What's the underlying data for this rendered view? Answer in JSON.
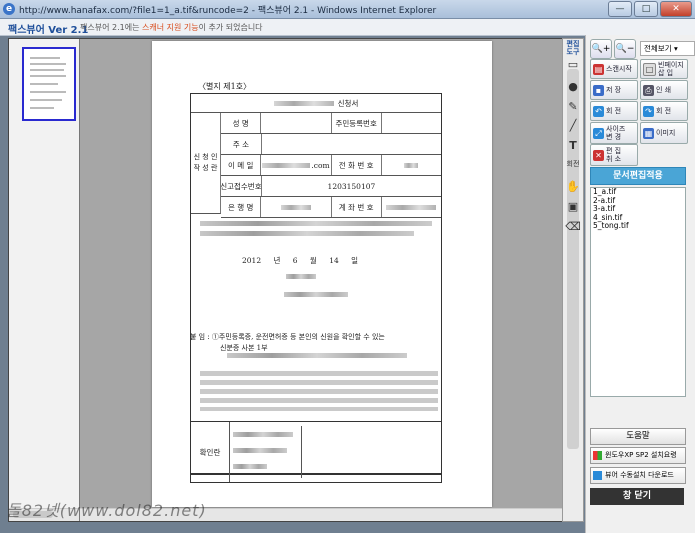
{
  "window": {
    "title": "http://www.hanafax.com/?file1=1_a.tif&runcode=2 - 팩스뷰어 2.1 - Windows Internet Explorer",
    "controls": {
      "minimize": "—",
      "maximize": "□",
      "close": "✕"
    }
  },
  "app": {
    "brand": "팩스뷰어 Ver 2.1",
    "notice_pre": "팩스뷰어 2.1에는 ",
    "notice_hl": "스캐너 지원 기능",
    "notice_post": "이 추가 되었습니다"
  },
  "document": {
    "form_no": "〈별지 제1호〉",
    "title": "신청서",
    "rows": {
      "name": "성  명",
      "resident_no": "주민등록번호",
      "address": "주  소",
      "email": "이 메 일",
      "email_suffix": ".com",
      "phone": "전 화 번 호",
      "applicant": "신 청 인\n작 성 란",
      "report_no": "신고접수번호",
      "report_no_value": "1203150107",
      "bank": "은 행 명",
      "account": "계 좌 번 호"
    },
    "date_year": "2012 년",
    "date_month": "6 월",
    "date_day": "14 일",
    "attach_text": "붙 임 : ①주민등록증, 운전면허증 등        본인의 신원을 확인할 수 있는",
    "attach_text2": "신분증 사본 1부",
    "confirm_label": "확인란"
  },
  "tools": {
    "edit_tools": "편집\n도구",
    "rotate": "회전"
  },
  "side": {
    "zoom_in": "🔍+",
    "zoom_out": "🔍−",
    "view_mode": "전체보기",
    "buttons": {
      "scan_start": "스캔시작",
      "insert_page": "빈페이지\n삽  입",
      "save": "저  장",
      "print": "인  쇄",
      "rotate_left": "회  전",
      "rotate_right": "회  전",
      "resize": "사이즈\n변  경",
      "image": "이미지",
      "cancel_edit": "편  집\n취  소"
    },
    "apply_label": "문서편집적용",
    "files": [
      "1_a.tif",
      "2-a.tif",
      "3-a.tif",
      "4_sin.tif",
      "5_tong.tif"
    ],
    "help_label": "도움말",
    "promo_winxp": "윈도우XP  SP2 설치요령",
    "promo_manual": "뷰어 수동설치 다운로드",
    "close_label": "창 닫기"
  },
  "watermark": "돌82넷(www.dol82.net)"
}
